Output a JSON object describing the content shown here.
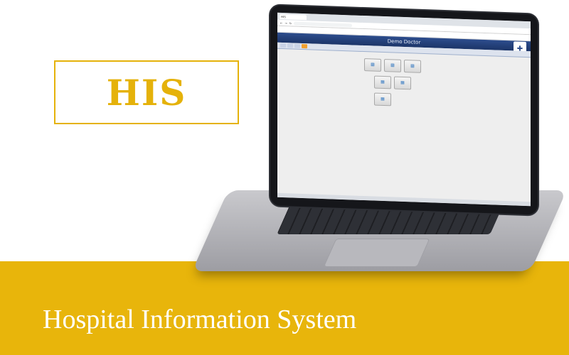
{
  "logo_box": {
    "text": "HIS"
  },
  "banner": {
    "title": "Hospital Information System"
  },
  "colors": {
    "accent": "#e8b50b",
    "header_blue": "#1c3568",
    "white": "#ffffff"
  },
  "screen": {
    "browser_tab": "HIS",
    "url": "",
    "header": {
      "left": "",
      "center": "Demo Doctor"
    },
    "nav_tabs": [
      "",
      "",
      "",
      ""
    ],
    "tiles": [
      {
        "label": "",
        "icon": "chart-icon"
      },
      {
        "label": "",
        "icon": "chart-icon"
      },
      {
        "label": "",
        "icon": "chart-icon"
      },
      {
        "label": "",
        "icon": "chart-icon"
      },
      {
        "label": "",
        "icon": "chart-icon"
      },
      {
        "label": "",
        "icon": "chart-icon"
      }
    ]
  }
}
